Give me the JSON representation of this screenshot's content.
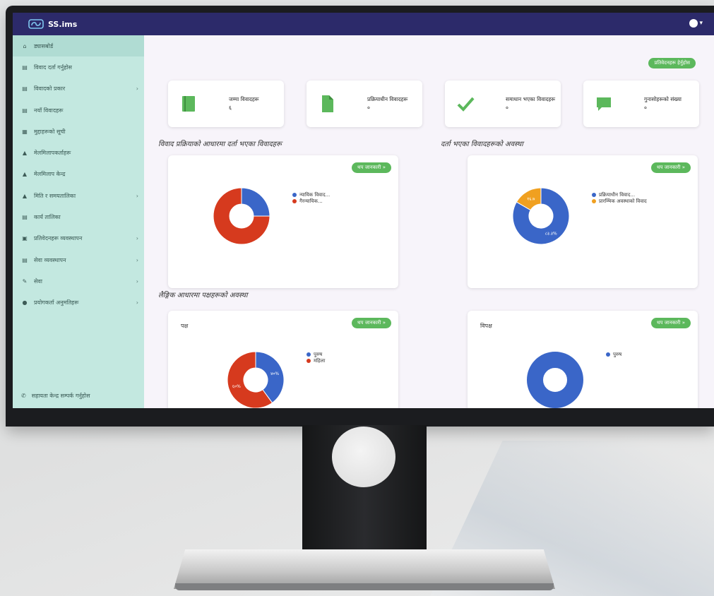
{
  "app": {
    "name": "SS.ims"
  },
  "colors": {
    "topbar": "#2c2a6a",
    "sidebar": "#c3e8e0",
    "blue": "#3a66c8",
    "red": "#d63a1e",
    "orange": "#f0a020",
    "green": "#5cb85c"
  },
  "sidebar": {
    "items": [
      {
        "label": "ड्यासबोर्ड",
        "icon": "home-icon",
        "active": true
      },
      {
        "label": "विवाद दर्ता गर्नुहोस",
        "icon": "list-icon"
      },
      {
        "label": "विवादको प्रकार",
        "icon": "list-icon",
        "chevron": true
      },
      {
        "label": "नयाँ विवादहरू",
        "icon": "list-icon"
      },
      {
        "label": "मुद्दाहरूको सूची",
        "icon": "calendar-icon"
      },
      {
        "label": "मेलमिलापकर्ताहरू",
        "icon": "user-icon"
      },
      {
        "label": "मेलमिलाप केन्द्र",
        "icon": "user-icon"
      },
      {
        "label": "मिति र समयतालिका",
        "icon": "user-icon",
        "chevron": true
      },
      {
        "label": "कार्य तालिका",
        "icon": "list-icon"
      },
      {
        "label": "प्रतिवेदनहरू व्यवस्थापन",
        "icon": "briefcase-icon",
        "chevron": true
      },
      {
        "label": "सेवा व्यवस्थापन",
        "icon": "list-icon",
        "chevron": true
      },
      {
        "label": "सेवा",
        "icon": "wrench-icon",
        "chevron": true
      },
      {
        "label": "प्रयोगकर्ता अनुमतिहरू",
        "icon": "lock-icon",
        "chevron": true
      }
    ],
    "footer": "सहायता केन्द्र सम्पर्क गर्नुहोस"
  },
  "main": {
    "top_button": "प्रतिवेदनहरू हेर्नुहोस",
    "stats": [
      {
        "label": "जम्मा विवादहरू",
        "value": "६",
        "icon": "book-icon"
      },
      {
        "label": "प्रक्रियाधीन विवादहरू",
        "value": "०",
        "icon": "file-icon"
      },
      {
        "label": "समाधान भएका विवादहरू",
        "value": "०",
        "icon": "check-icon"
      },
      {
        "label": "गुनासोहरूको संख्या",
        "value": "०",
        "icon": "comment-icon"
      }
    ],
    "section1_left": "विवाद प्रक्रियाको आधारमा दर्ता भएका विवादहरू",
    "section1_right": "दर्ता भएका विवादहरूको अवस्था",
    "section2": "लैङ्गिक आधारमा पक्षहरूको अवस्था",
    "more_label": "थप जानकारी »",
    "panels": [
      {
        "title": "",
        "legend": [
          {
            "label": "न्यायिक विवाद...",
            "color": "#3a66c8"
          },
          {
            "label": "गैरन्यायिक...",
            "color": "#d63a1e"
          }
        ],
        "slices": [
          {
            "value": 25,
            "color": "#3a66c8"
          },
          {
            "value": 75,
            "color": "#d63a1e"
          }
        ],
        "labels": []
      },
      {
        "title": "",
        "legend": [
          {
            "label": "प्रक्रियाधीन विवाद...",
            "color": "#3a66c8"
          },
          {
            "label": "प्रारम्भिक अवस्थाको विवाद",
            "color": "#f0a020"
          }
        ],
        "slices": [
          {
            "value": 83.3,
            "color": "#3a66c8"
          },
          {
            "value": 16.7,
            "color": "#f0a020"
          }
        ],
        "labels": [
          "८३.३%",
          "१६.७"
        ]
      },
      {
        "title": "पक्ष",
        "legend": [
          {
            "label": "पुरुष",
            "color": "#3a66c8"
          },
          {
            "label": "महिला",
            "color": "#d63a1e"
          }
        ],
        "slices": [
          {
            "value": 40,
            "color": "#3a66c8"
          },
          {
            "value": 60,
            "color": "#d63a1e"
          }
        ],
        "labels": [
          "४०%",
          "६०%"
        ]
      },
      {
        "title": "विपक्ष",
        "legend": [
          {
            "label": "पुरुष",
            "color": "#3a66c8"
          }
        ],
        "slices": [
          {
            "value": 100,
            "color": "#3a66c8"
          }
        ],
        "labels": []
      }
    ]
  }
}
